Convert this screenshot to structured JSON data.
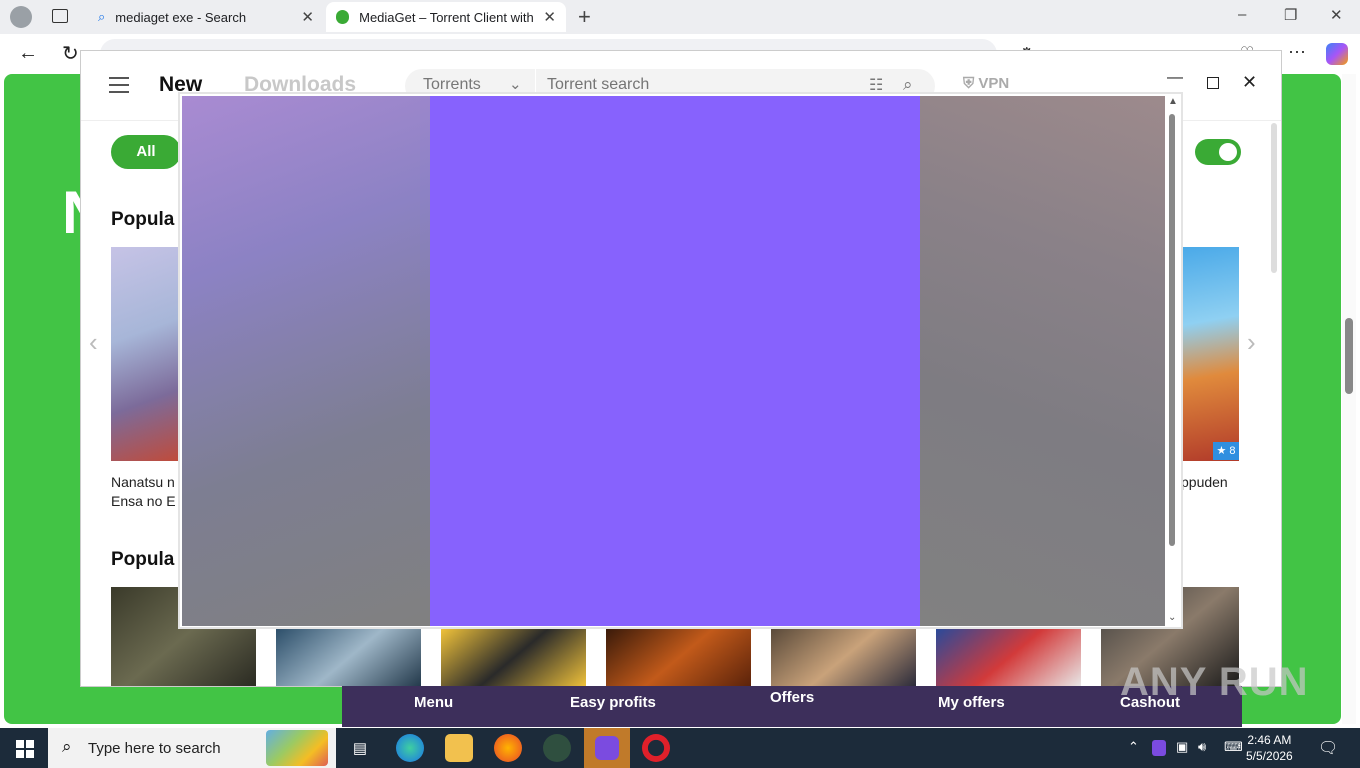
{
  "browser": {
    "tabs": [
      {
        "title": "mediaget exe - Search"
      },
      {
        "title": "MediaGet – Torrent Client with Se"
      }
    ]
  },
  "page": {
    "green_letter": "N"
  },
  "mediaget": {
    "nav": {
      "new": "New",
      "downloads": "Downloads"
    },
    "search": {
      "category": "Torrents",
      "placeholder": "Torrent search"
    },
    "vpn": "VPN",
    "filter_all": "All",
    "section1_title": "Popula",
    "section1_caption_left": "Nanatsu n\nEnsa no E",
    "section1_caption_right": "ppuden",
    "section2_title": "Popula",
    "rating_badge": "★ 8"
  },
  "offer_menu": {
    "items": [
      "Menu",
      "Easy profits",
      "Offers",
      "My offers",
      "Cashout"
    ]
  },
  "watermark": "ANY RUN",
  "taskbar": {
    "search_placeholder": "Type here to search",
    "time": "2:46 AM",
    "date": "5/5/2026"
  },
  "colors": {
    "page_green": "#42c445",
    "accent_green": "#3aaa35",
    "popup_purple": "#8762fd",
    "offer_bar": "#3d2f5b"
  }
}
